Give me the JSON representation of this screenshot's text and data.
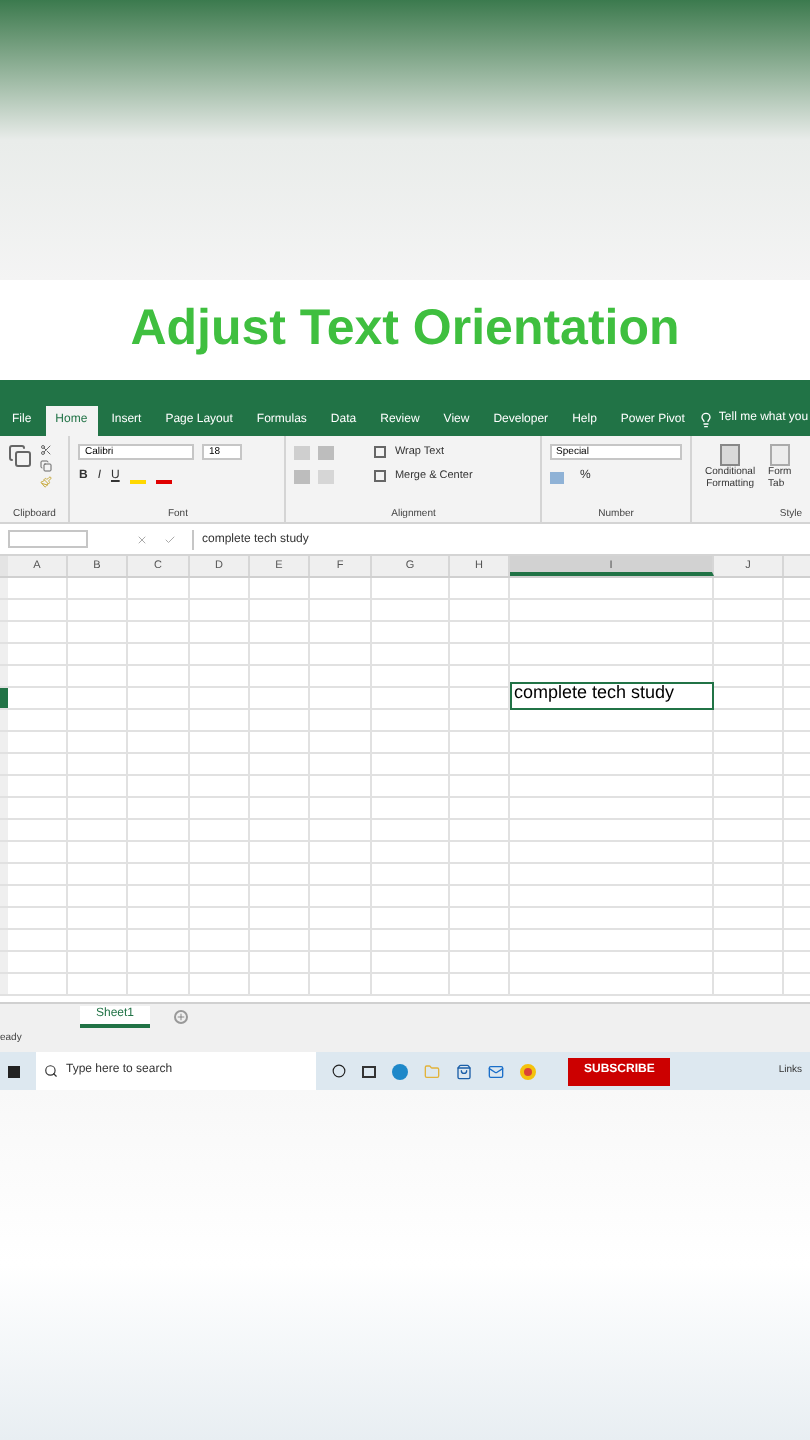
{
  "video_title": "Adjust Text Orientation",
  "ribbon_tabs": [
    {
      "label": "File",
      "selected": false
    },
    {
      "label": "Home",
      "selected": true
    },
    {
      "label": "Insert",
      "selected": false
    },
    {
      "label": "Page Layout",
      "selected": false
    },
    {
      "label": "Formulas",
      "selected": false
    },
    {
      "label": "Data",
      "selected": false
    },
    {
      "label": "Review",
      "selected": false
    },
    {
      "label": "View",
      "selected": false
    },
    {
      "label": "Developer",
      "selected": false
    },
    {
      "label": "Help",
      "selected": false
    },
    {
      "label": "Power Pivot",
      "selected": false
    }
  ],
  "tell_me": "Tell me what you",
  "font": {
    "name": "Calibri",
    "size": "18",
    "style_buttons": [
      "B",
      "I",
      "U"
    ]
  },
  "alignment": {
    "wrap_text": "Wrap Text",
    "merge": "Merge & Center"
  },
  "number": {
    "format": "Special",
    "percent": "%"
  },
  "styles": {
    "conditional": "Conditional Formatting",
    "format_table": "Form Tab"
  },
  "group_labels": [
    "Clipboard",
    "Font",
    "Alignment",
    "Number",
    "Style"
  ],
  "formula_bar": {
    "value": "complete tech study"
  },
  "columns": [
    {
      "label": "A",
      "selected": false
    },
    {
      "label": "B",
      "selected": false
    },
    {
      "label": "C",
      "selected": false
    },
    {
      "label": "D",
      "selected": false
    },
    {
      "label": "E",
      "selected": false
    },
    {
      "label": "F",
      "selected": false
    },
    {
      "label": "G",
      "selected": false
    },
    {
      "label": "H",
      "selected": false
    },
    {
      "label": "I",
      "selected": true
    },
    {
      "label": "J",
      "selected": false
    }
  ],
  "selected_cell": {
    "value": "complete tech study"
  },
  "sheet_tabs": [
    {
      "label": "Sheet1",
      "selected": true
    }
  ],
  "status": "eady",
  "taskbar": {
    "search_placeholder": "Type here to search",
    "subscribe": "SUBSCRIBE",
    "links": "Links"
  }
}
